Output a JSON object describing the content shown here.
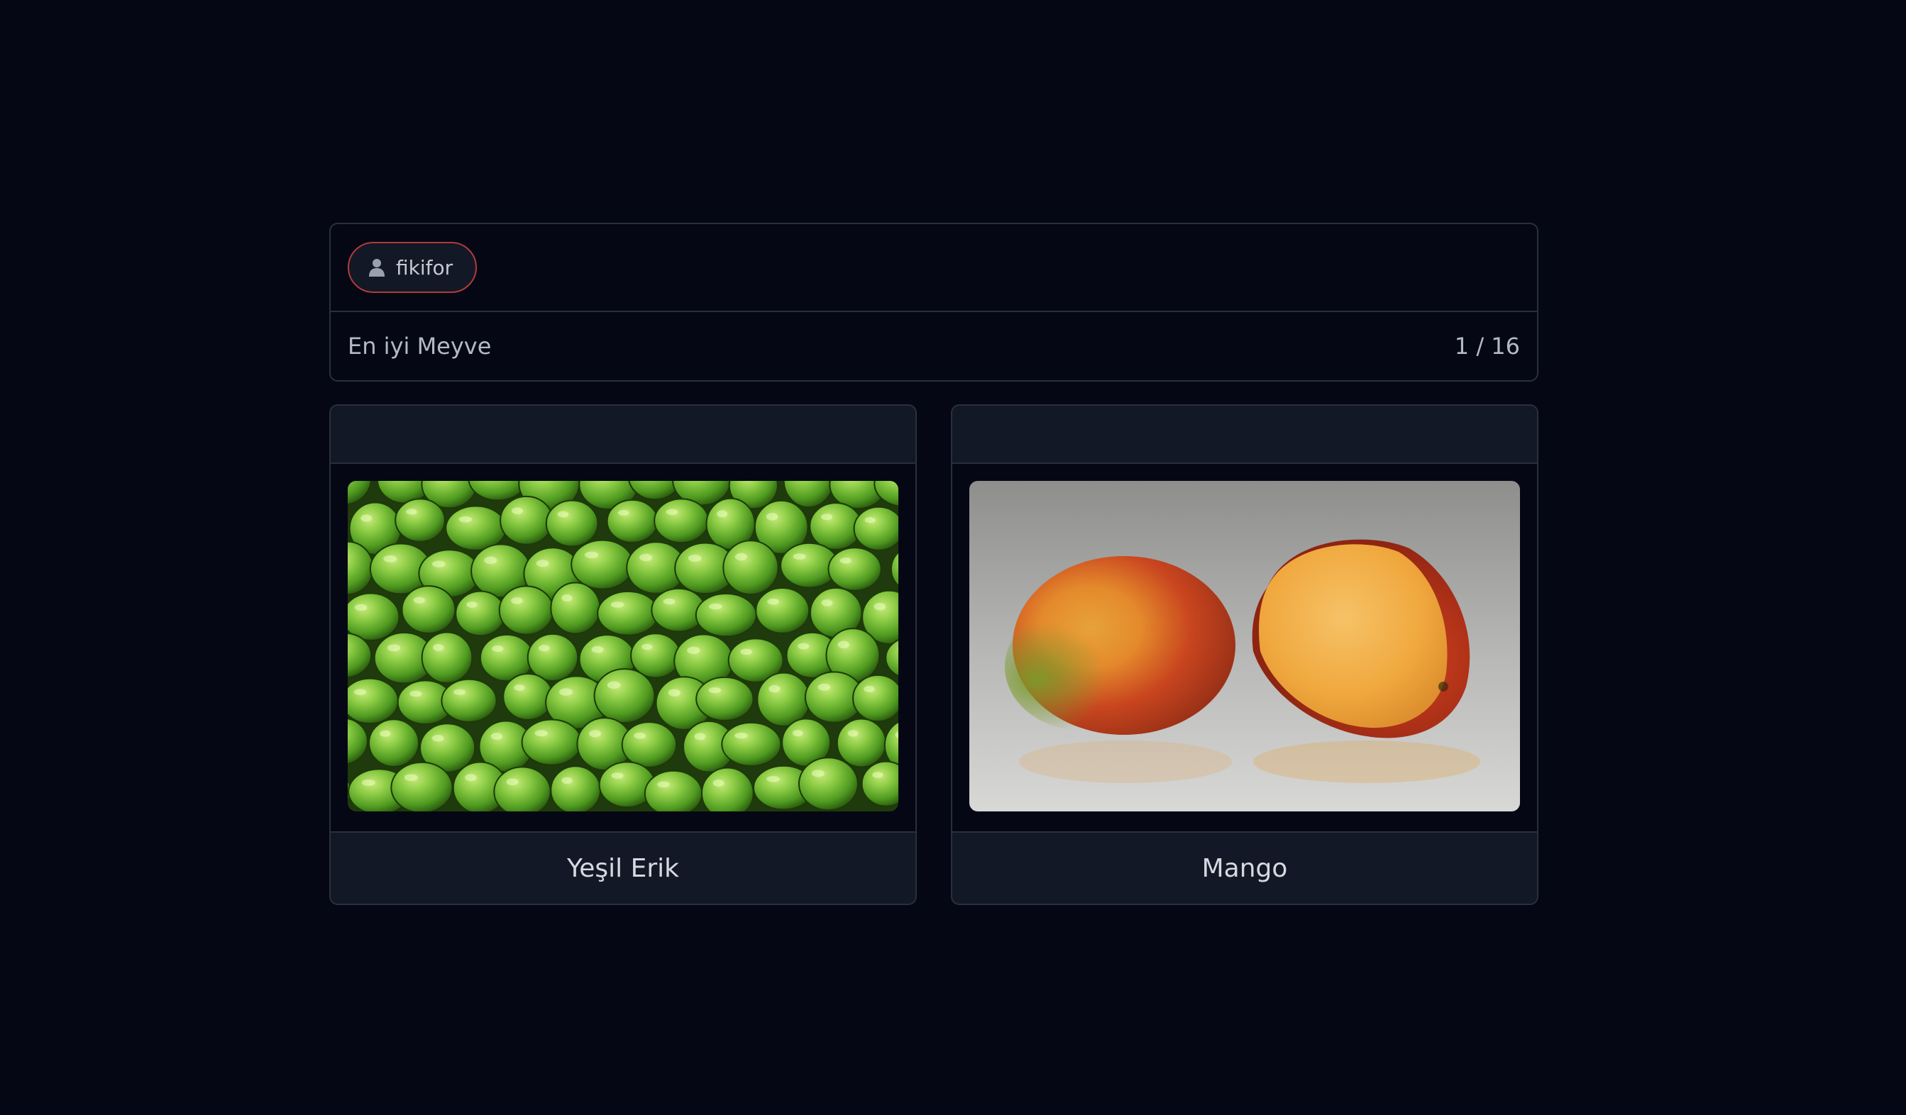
{
  "header": {
    "username": "fikifor",
    "user_icon": "user-icon",
    "title": "En iyi Meyve",
    "counter": "1 / 16"
  },
  "options": [
    {
      "label": "Yeşil Erik",
      "image": "green-plums-photo"
    },
    {
      "label": "Mango",
      "image": "mango-photo"
    }
  ],
  "colors": {
    "background": "#050814",
    "card": "#121826",
    "border": "#2a2f3d",
    "chip_border": "#b23a3a"
  }
}
